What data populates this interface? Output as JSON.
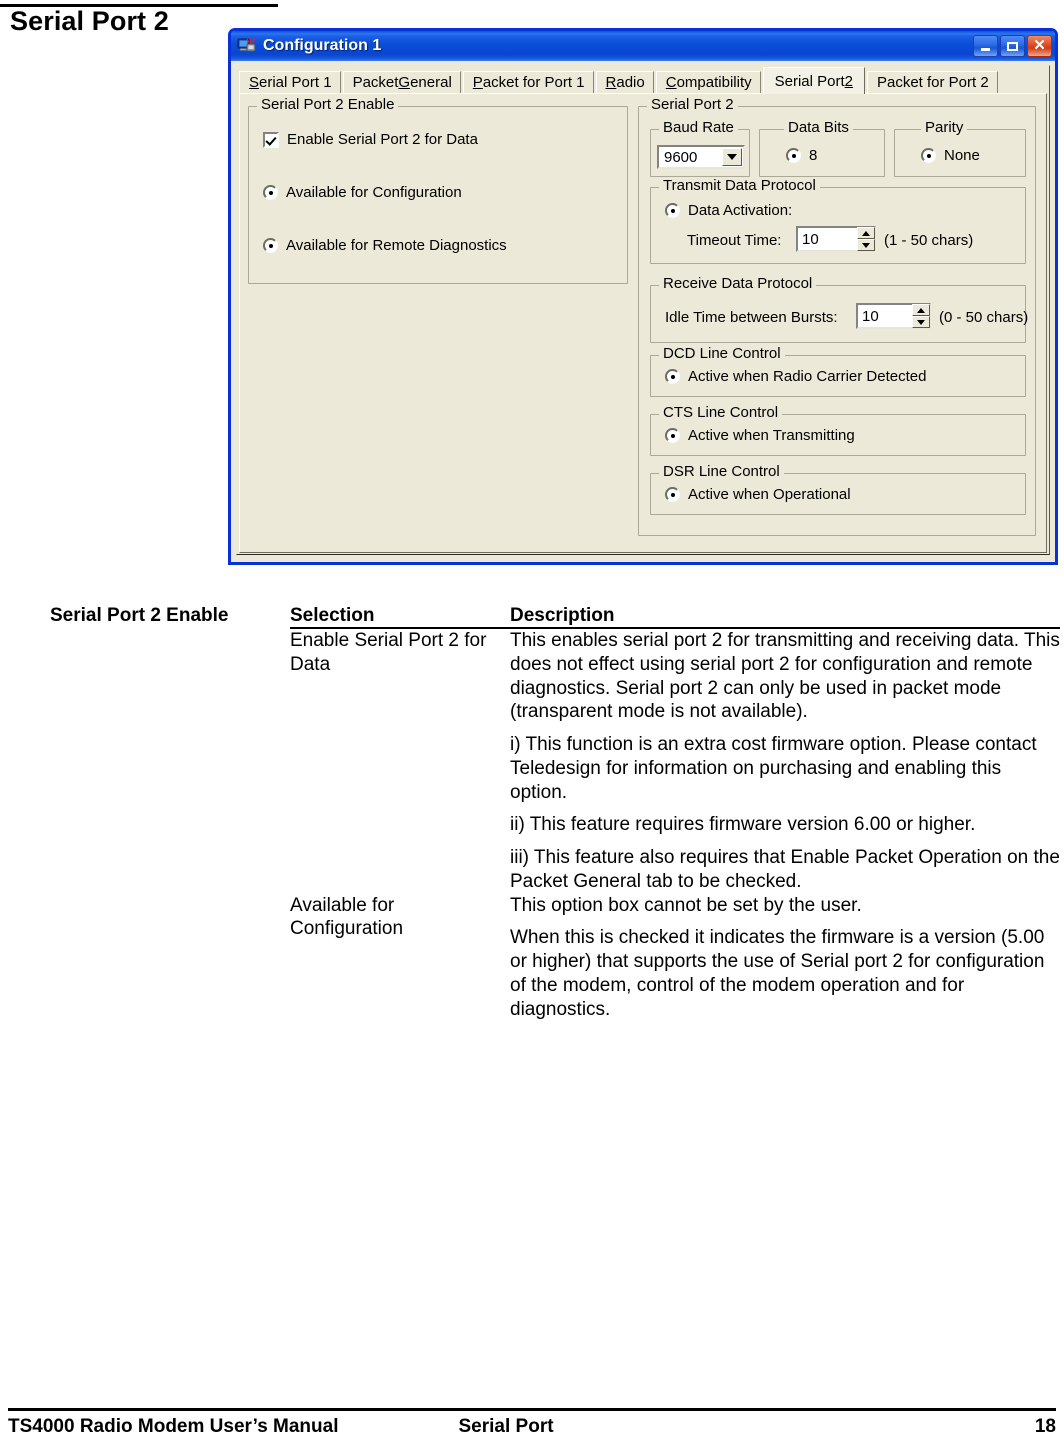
{
  "page": {
    "heading": "Serial Port 2"
  },
  "dialog": {
    "title": "Configuration 1",
    "icon": "computer-network-icon",
    "window_buttons": {
      "minimize": "minimize-icon",
      "maximize": "maximize-icon",
      "close": "close-icon"
    },
    "tabs": [
      {
        "label": "Serial Port 1",
        "pre": "S",
        "mnemonic": "S",
        "selected": false
      },
      {
        "label": "Packet General",
        "pre": "Packet ",
        "mnemonic": "G",
        "selected": false
      },
      {
        "label": "Packet for Port 1",
        "pre": "",
        "mnemonic": "P",
        "selected": false
      },
      {
        "label": "Radio",
        "pre": "",
        "mnemonic": "R",
        "selected": false
      },
      {
        "label": "Compatibility",
        "pre": "",
        "mnemonic": "C",
        "selected": false
      },
      {
        "label": "Serial Port 2",
        "pre": "Serial Port ",
        "mnemonic": "2",
        "selected": true
      },
      {
        "label": "Packet for Port 2",
        "pre": "",
        "mnemonic": "",
        "selected": false
      }
    ],
    "left_group": {
      "legend": "Serial Port 2 Enable",
      "checkbox": {
        "label": "Enable Serial Port 2 for Data",
        "checked": true
      },
      "radios": [
        {
          "label": "Available for Configuration",
          "selected": true
        },
        {
          "label": "Available for Remote Diagnostics",
          "selected": true
        }
      ]
    },
    "right_group": {
      "legend": "Serial Port 2",
      "baud_rate": {
        "legend": "Baud Rate",
        "value": "9600"
      },
      "data_bits": {
        "legend": "Data Bits",
        "option": "8",
        "selected": true
      },
      "parity": {
        "legend": "Parity",
        "option": "None",
        "selected": true
      },
      "transmit": {
        "legend": "Transmit Data Protocol",
        "radio_label": "Data Activation:",
        "field_label": "Timeout Time:",
        "value": "10",
        "range": "(1 - 50 chars)"
      },
      "receive": {
        "legend": "Receive Data Protocol",
        "field_label": "Idle Time between Bursts:",
        "value": "10",
        "range": "(0 - 50 chars)"
      },
      "dcd": {
        "legend": "DCD Line Control",
        "option": "Active when Radio Carrier Detected",
        "selected": true
      },
      "cts": {
        "legend": "CTS Line Control",
        "option": "Active when Transmitting",
        "selected": true
      },
      "dsr": {
        "legend": "DSR Line Control",
        "option": "Active when Operational",
        "selected": true
      }
    }
  },
  "table": {
    "row_label": "Serial Port 2 Enable",
    "headers": {
      "selection": "Selection",
      "description": "Description"
    },
    "rows": [
      {
        "selection": "Enable Serial Port 2 for Data",
        "description": [
          "This enables serial port 2 for transmitting and receiving data.  This does not effect using serial port 2 for configuration and remote diagnostics.  Serial port 2 can only be used in packet mode (transparent mode is not available).",
          "i) This function is an extra cost firmware option.  Please contact Teledesign for information on purchasing and enabling this option.",
          "ii) This feature requires firmware version 6.00 or higher.",
          "iii) This feature also requires that Enable Packet Operation on the Packet General tab to be checked."
        ]
      },
      {
        "selection": "Available for Configuration",
        "description": [
          "This option box cannot be set by the user.",
          "When this is checked it indicates the firmware is a version (5.00 or higher) that supports the use of Serial port 2 for configuration of the modem, control of the modem operation and for diagnostics."
        ]
      }
    ]
  },
  "footer": {
    "left": "TS4000 Radio Modem User’s Manual",
    "center": "Serial Port",
    "page_number": "18"
  }
}
